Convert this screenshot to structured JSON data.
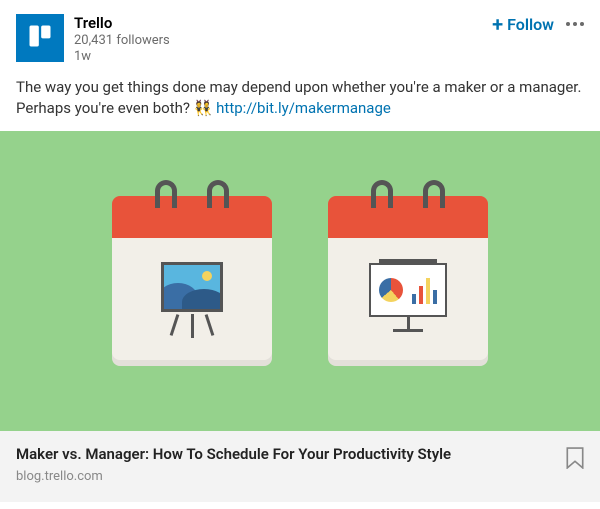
{
  "author": {
    "name": "Trello",
    "followers": "20,431 followers",
    "time": "1w"
  },
  "actions": {
    "follow_label": "Follow"
  },
  "post_text": {
    "body": "The way you get things done may depend upon whether you're a maker or a manager. Perhaps you're even both?",
    "emoji": "👯",
    "link": "http://bit.ly/makermanage"
  },
  "card": {
    "title": "Maker vs. Manager: How To Schedule For Your Productivity Style",
    "source": "blog.trello.com"
  },
  "colors": {
    "brand": "#0079bf",
    "link": "#0073b1",
    "image_bg": "#95d28c",
    "accent": "#e8533a"
  }
}
